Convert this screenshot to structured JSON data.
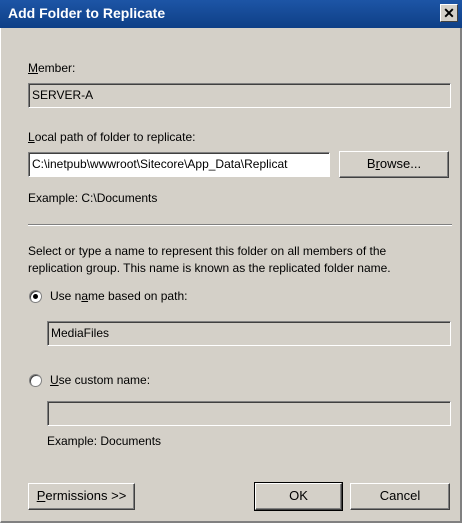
{
  "window": {
    "title": "Add Folder to Replicate",
    "close_glyph": "✕"
  },
  "member": {
    "label_accel": "M",
    "label_rest": "ember:",
    "value": "SERVER-A"
  },
  "local_path": {
    "label_accel": "L",
    "label_rest": "ocal path of folder to replicate:",
    "value": "C:\\inetpub\\wwwroot\\Sitecore\\App_Data\\Replicat",
    "browse_pre": "B",
    "browse_accel": "r",
    "browse_rest": "owse...",
    "example": "Example: C:\\Documents"
  },
  "description": {
    "line1": "Select or type a name to represent this folder on all members of the",
    "line2": "replication group. This name is known as the replicated folder name."
  },
  "option_path": {
    "label_pre": "Use n",
    "label_accel": "a",
    "label_rest": "me based on path:",
    "selected": true,
    "value": "MediaFiles"
  },
  "option_custom": {
    "label_accel": "U",
    "label_rest": "se custom name:",
    "selected": false,
    "value": "",
    "example": "Example: Documents"
  },
  "buttons": {
    "permissions_accel": "P",
    "permissions_rest": "ermissions >>",
    "ok": "OK",
    "cancel": "Cancel"
  }
}
